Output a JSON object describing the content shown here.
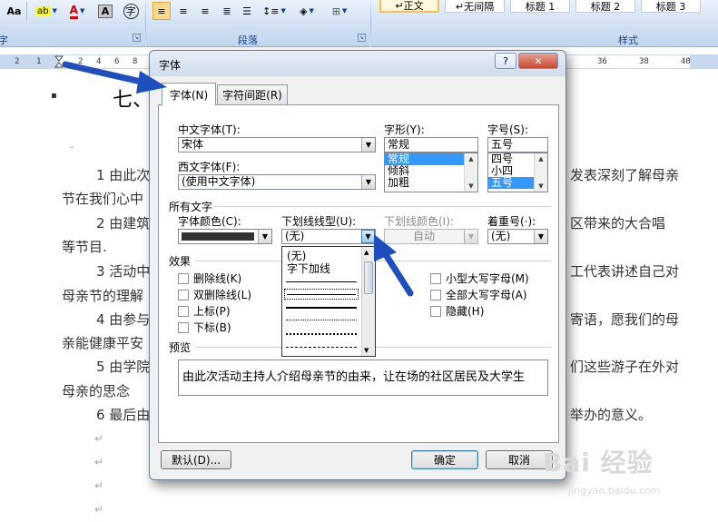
{
  "ribbon": {
    "font_button": "Aa",
    "highlight_label": "ab",
    "font_color_label": "A",
    "char_shading_label": "A",
    "encircle_label": "字",
    "group_label_font": "字",
    "group_label_paragraph": "段落",
    "group_label_styles": "样式",
    "style_items": [
      "↵正文",
      "↵无间隔",
      "标题 1",
      "标题 2",
      "标题 3"
    ]
  },
  "ruler": {
    "marks": [
      "2",
      "1",
      "2",
      "4",
      "6",
      "8",
      "10",
      "36",
      "38",
      "40"
    ]
  },
  "document": {
    "heading_char": "七、",
    "bullet": "▪",
    "lines": [
      "1 由此次",
      "节在我们心中",
      "2 由建筑",
      "等节目.",
      "3 活动中",
      "母亲节的理解",
      "4 由参与",
      "亲能健康平安",
      "5 由学院",
      "母亲的思念",
      "6 最后由"
    ],
    "right_lines": [
      "发表深刻了解母亲",
      "区带来的大合唱",
      "工代表讲述自己对",
      "寄语，愿我们的母",
      "们这些游子在外对",
      "举办的意义。"
    ]
  },
  "dialog": {
    "title": "字体",
    "help": "?",
    "close": "✕",
    "tabs": [
      "字体(N)",
      "字符间距(R)"
    ],
    "labels": {
      "cjk_font": "中文字体(T):",
      "western_font": "西文字体(F):",
      "style": "字形(Y):",
      "size": "字号(S):",
      "all_text": "所有文字",
      "font_color": "字体颜色(C):",
      "underline_type": "下划线线型(U):",
      "underline_color": "下划线颜色(I):",
      "emphasis": "着重号(·):",
      "effects": "效果",
      "preview": "预览"
    },
    "values": {
      "cjk_font": "宋体",
      "western_font": "(使用中文字体)",
      "style_input": "常规",
      "size_input": "五号",
      "underline_type": "(无)",
      "underline_color": "自动",
      "emphasis": "(无)"
    },
    "style_list": [
      "常规",
      "倾斜",
      "加粗"
    ],
    "size_list": [
      "四号",
      "小四",
      "五号"
    ],
    "underline_options": [
      "(无)",
      "字下加线"
    ],
    "effects_left": [
      "删除线(K)",
      "双删除线(L)",
      "上标(P)",
      "下标(B)"
    ],
    "effects_right": [
      "小型大写字母(M)",
      "全部大写字母(A)",
      "隐藏(H)"
    ],
    "preview_text": "由此次活动主持人介绍母亲节的由来，让在场的社区居民及大学生",
    "buttons": {
      "default": "默认(D)...",
      "ok": "确定",
      "cancel": "取消"
    }
  },
  "watermark": {
    "main": "Bai 经验",
    "sub": "jingyan.baidu.com"
  },
  "colors": {
    "arrow": "#1f4fbf",
    "selection": "#3399ff",
    "ribbon_text": "#15428b"
  }
}
